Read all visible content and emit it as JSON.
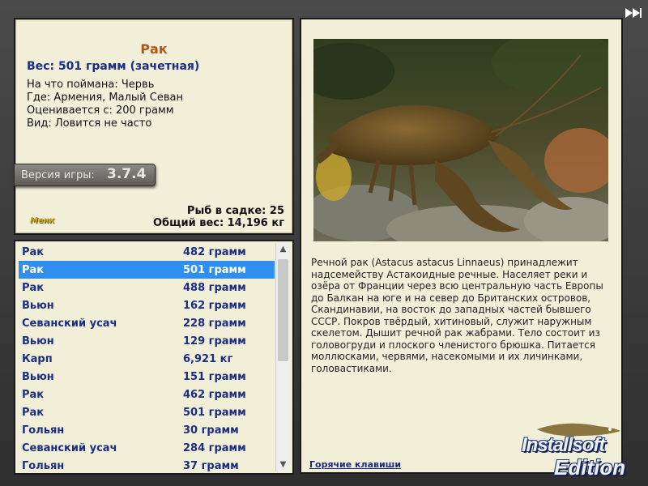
{
  "catch": {
    "title": "Рак",
    "weight": "Вес: 501 грамм (зачетная)",
    "bait": "На что поймана: Червь",
    "place": "Где: Армения, Малый Севан",
    "min_weight": "Оценивается с: 200 грамм",
    "rarity": "Вид: Ловится не часто",
    "logo": "Менк"
  },
  "version": {
    "label": "Версия игры:",
    "number": "3.7.4"
  },
  "tank": {
    "count": "Рыб в садке: 25",
    "total": "Общий вес: 14,196 кг"
  },
  "list": {
    "rows": [
      {
        "name": "Рак",
        "weight": "482 грамм"
      },
      {
        "name": "Рак",
        "weight": "501 грамм"
      },
      {
        "name": "Рак",
        "weight": "488 грамм"
      },
      {
        "name": "Вьюн",
        "weight": "162 грамм"
      },
      {
        "name": "Севанский усач",
        "weight": "228 грамм"
      },
      {
        "name": "Вьюн",
        "weight": "129 грамм"
      },
      {
        "name": "Карп",
        "weight": "6,921 кг"
      },
      {
        "name": "Вьюн",
        "weight": "151 грамм"
      },
      {
        "name": "Рак",
        "weight": "462 грамм"
      },
      {
        "name": "Рак",
        "weight": "501 грамм"
      },
      {
        "name": "Гольян",
        "weight": "30 грамм"
      },
      {
        "name": "Севанский усач",
        "weight": "284 грамм"
      },
      {
        "name": "Гольян",
        "weight": "37 грамм"
      }
    ],
    "selected_index": 1
  },
  "description": "Речной рак (Astacus astacus Linnaeus) принадлежит надсемейству Астакоидные речные. Населяет реки и озёра от Франции через всю центральную часть Европы до Балкан на юге и на север до Британских островов, Скандинавии, на восток до западных частей бывшего СССР. Покров твёрдый, хитиновый, служит наружным скелетом. Дышит речной рак жабрами. Тело состоит из головогруди и плоского членистого брюшка. Питается моллюсками, червями, насекомыми и их личинками, головастиками.",
  "hotkeys_link": "Горячие клавиши",
  "badge": {
    "line1": "Installsoft",
    "line2": "Edition"
  },
  "colors": {
    "panel": "#f2efd8",
    "title": "#b5531a",
    "text_blue": "#1c2e84",
    "selection": "#2f8ff0"
  }
}
